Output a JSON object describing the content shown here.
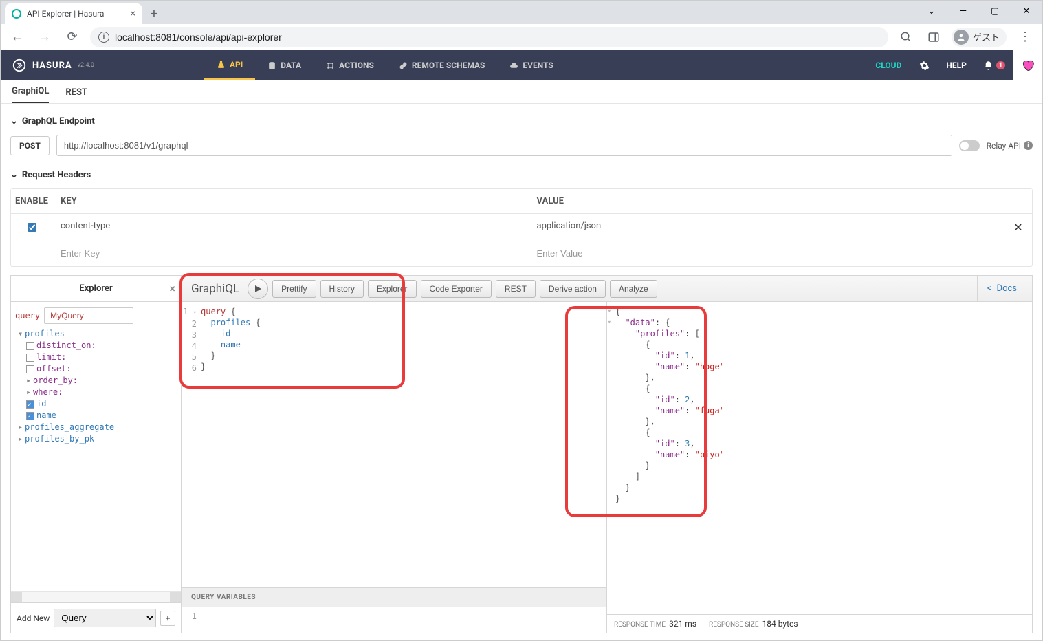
{
  "browser": {
    "tab_title": "API Explorer | Hasura",
    "url": "localhost:8081/console/api/api-explorer",
    "guest_label": "ゲスト"
  },
  "hasura": {
    "brand": "HASURA",
    "version": "v2.4.0",
    "nav": {
      "api": "API",
      "data": "DATA",
      "actions": "ACTIONS",
      "remote": "REMOTE SCHEMAS",
      "events": "EVENTS"
    },
    "cloud": "CLOUD",
    "help": "HELP",
    "notif_count": "1"
  },
  "subtabs": {
    "graphiql": "GraphiQL",
    "rest": "REST"
  },
  "endpoint": {
    "section": "GraphQL Endpoint",
    "method": "POST",
    "url": "http://localhost:8081/v1/graphql",
    "relay": "Relay API"
  },
  "headers": {
    "section": "Request Headers",
    "col_enable": "ENABLE",
    "col_key": "KEY",
    "col_value": "VALUE",
    "row1_key": "content-type",
    "row1_value": "application/json",
    "key_placeholder": "Enter Key",
    "value_placeholder": "Enter Value"
  },
  "explorer": {
    "title": "Explorer",
    "query_kw": "query",
    "query_name": "MyQuery",
    "root_profiles": "profiles",
    "arg_distinct": "distinct_on:",
    "arg_limit": "limit:",
    "arg_offset": "offset:",
    "arg_orderby": "order_by:",
    "arg_where": "where:",
    "field_id": "id",
    "field_name": "name",
    "root_agg": "profiles_aggregate",
    "root_bypk": "profiles_by_pk",
    "addnew": "Add New",
    "addnew_opt": "Query"
  },
  "graphiql": {
    "title": "GraphiQL",
    "btn_prettify": "Prettify",
    "btn_history": "History",
    "btn_explorer": "Explorer",
    "btn_codeexp": "Code Exporter",
    "btn_rest": "REST",
    "btn_derive": "Derive action",
    "btn_analyze": "Analyze",
    "docs": "Docs",
    "query_lines": {
      "l1a": "query",
      "l1b": " {",
      "l2a": "  profiles",
      "l2b": " {",
      "l3": "    id",
      "l4": "    name",
      "l5": "  }",
      "l6": "}"
    },
    "qvars": "QUERY VARIABLES",
    "result": {
      "profiles": [
        {
          "id": 1,
          "name": "hoge"
        },
        {
          "id": 2,
          "name": "fuga"
        },
        {
          "id": 3,
          "name": "piyo"
        }
      ]
    },
    "resp_time_label": "RESPONSE TIME",
    "resp_time": "321 ms",
    "resp_size_label": "RESPONSE SIZE",
    "resp_size": "184 bytes"
  }
}
